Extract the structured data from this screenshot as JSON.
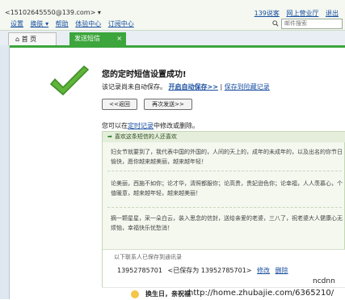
{
  "header": {
    "account": "<15102645550@139.com> ▾",
    "nav": [
      "设置",
      "换肤 ▾",
      "帮助",
      "体验中心",
      "订阅中心"
    ],
    "toplinks": [
      "139说客",
      "网上营业厅",
      "退出"
    ],
    "search_placeholder": "邮件搜索"
  },
  "tabs": {
    "home": "首 页",
    "sms": "发送短信",
    "close": "×"
  },
  "result": {
    "title": "您的定时短信设置成功!",
    "desc_prefix": "该记录尚未自动保存。",
    "auto_save": "开启自动保存>>",
    "divider": "|",
    "save_draft": "保存到险藏记录",
    "back_button": "<<返回",
    "resend_button": "再次发送>>"
  },
  "modify_note": {
    "prefix": "您可以在",
    "link": "定时记录",
    "suffix": "中修改或删除。"
  },
  "card": {
    "heading": "喜欢这条短信的人还喜欢",
    "messages": [
      "妇女节就要到了，我代表中国的外国的，人间的天上的，成年的未成年的，以及出名的你节日愉快，愿你越来越美丽，越来越年轻！",
      "论美丽，西施不如你；论才华，清照都服你；论高贵，贵妃逊色你；论幸福，人人羡慕心，个值暖意，越来越年轻，越来越美丽！",
      "摘一颗星星，采一朵白云，装入思念的信封，送给亲爱的老婆，三八了，祝老婆大人健康心无烦恼，幸福快乐忧愁消！"
    ],
    "recent_label": "以下联系人已保存到通讯录",
    "recent_number": "13952785701",
    "recent_saved": "<已保存为 13952785701>",
    "edit_link": "修改",
    "delete_link": "删除"
  },
  "bottom": {
    "text": "换生日，亲祝福"
  },
  "watermark": {
    "user": "ncdnn",
    "url": "http://home.zhubajie.com/6365210/"
  },
  "colors": {
    "accent_green": "#3ca53c",
    "link_blue": "#1a4fa0"
  }
}
